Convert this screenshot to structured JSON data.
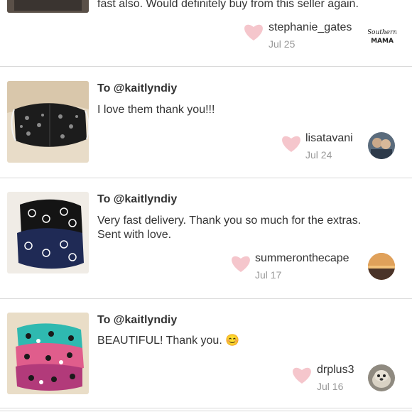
{
  "reviews": [
    {
      "to": "",
      "text": "fast also. Would definitely buy from this seller again.",
      "user": "stephanie_gates",
      "date": "Jul 25",
      "avatar_text": "Southern MAMA"
    },
    {
      "to": "To @kaitlyndiy",
      "text": "I love them thank you!!!",
      "user": "lisatavani",
      "date": "Jul 24"
    },
    {
      "to": "To @kaitlyndiy",
      "text": "Very fast delivery. Thank you so much for the extras. Sent with love.",
      "user": "summeronthecape",
      "date": "Jul 17"
    },
    {
      "to": "To @kaitlyndiy",
      "text": "BEAUTIFUL! Thank you. 😊",
      "user": "drplus3",
      "date": "Jul 16"
    }
  ],
  "colors": {
    "heart": "#f5c6cc",
    "divider": "#d9d9d9",
    "date": "#999999"
  }
}
